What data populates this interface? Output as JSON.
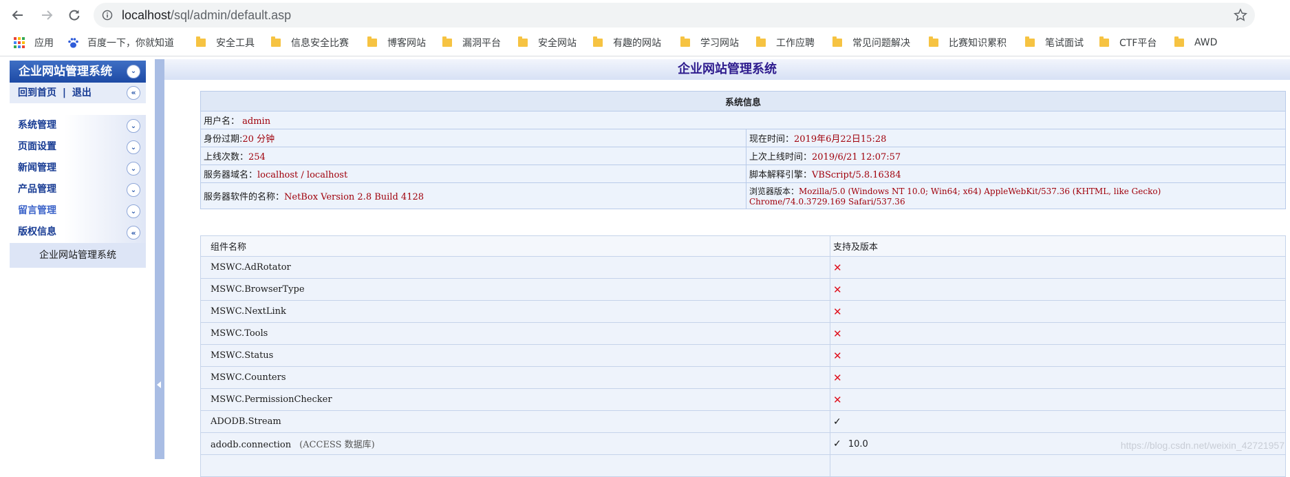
{
  "browser": {
    "url_host": "localhost",
    "url_path": "/sql/admin/default.asp",
    "bookmarks": [
      "应用",
      "百度一下，你就知道",
      "安全工具",
      "信息安全比赛",
      "博客网站",
      "漏洞平台",
      "安全网站",
      "有趣的网站",
      "学习网站",
      "工作应聘",
      "常见问题解决",
      "比赛知识累积",
      "笔试面试",
      "CTF平台",
      "AWD"
    ]
  },
  "sidebar": {
    "title": "企业网站管理系统",
    "home_link": "回到首页",
    "separator": "|",
    "logout_link": "退出",
    "items": [
      {
        "label": "系统管理"
      },
      {
        "label": "页面设置"
      },
      {
        "label": "新闻管理"
      },
      {
        "label": "产品管理"
      },
      {
        "label": "留言管理"
      },
      {
        "label": "版权信息"
      }
    ],
    "footer": "企业网站管理系统"
  },
  "main": {
    "title": "企业网站管理系统",
    "sysinfo": {
      "header": "系统信息",
      "username_label": "用户名：",
      "username": "admin",
      "expire_label": "身份过期:",
      "expire": "20 分钟",
      "now_label": "现在时间：",
      "now": "2019年6月22日15:28",
      "login_count_label": "上线次数：",
      "login_count": "254",
      "last_login_label": "上次上线时间：",
      "last_login": "2019/6/21 12:07:57",
      "server_domain_label": "服务器域名：",
      "server_domain": "localhost / localhost",
      "script_engine_label": "脚本解释引擎：",
      "script_engine": "VBScript/5.8.16384",
      "server_software_label": "服务器软件的名称：",
      "server_software": "NetBox Version 2.8 Build 4128",
      "browser_version_label": "浏览器版本：",
      "browser_version_line1": "Mozilla/5.0 (Windows NT 10.0; Win64; x64) AppleWebKit/537.36 (KHTML, like Gecko)",
      "browser_version_line2": "Chrome/74.0.3729.169 Safari/537.36"
    },
    "components": {
      "col_name": "组件名称",
      "col_support": "支持及版本",
      "rows": [
        {
          "name": "MSWC.AdRotator",
          "support": "✕",
          "version": ""
        },
        {
          "name": "MSWC.BrowserType",
          "support": "✕",
          "version": ""
        },
        {
          "name": "MSWC.NextLink",
          "support": "✕",
          "version": ""
        },
        {
          "name": "MSWC.Tools",
          "support": "✕",
          "version": ""
        },
        {
          "name": "MSWC.Status",
          "support": "✕",
          "version": ""
        },
        {
          "name": "MSWC.Counters",
          "support": "✕",
          "version": ""
        },
        {
          "name": "MSWC.PermissionChecker",
          "support": "✕",
          "version": ""
        },
        {
          "name": "ADODB.Stream",
          "support": "✓",
          "version": ""
        },
        {
          "name": "adodb.connection",
          "note": "(ACCESS 数据库)",
          "support": "✓",
          "version": "10.0"
        }
      ]
    }
  },
  "watermark": "https://blog.csdn.net/weixin_42721957"
}
